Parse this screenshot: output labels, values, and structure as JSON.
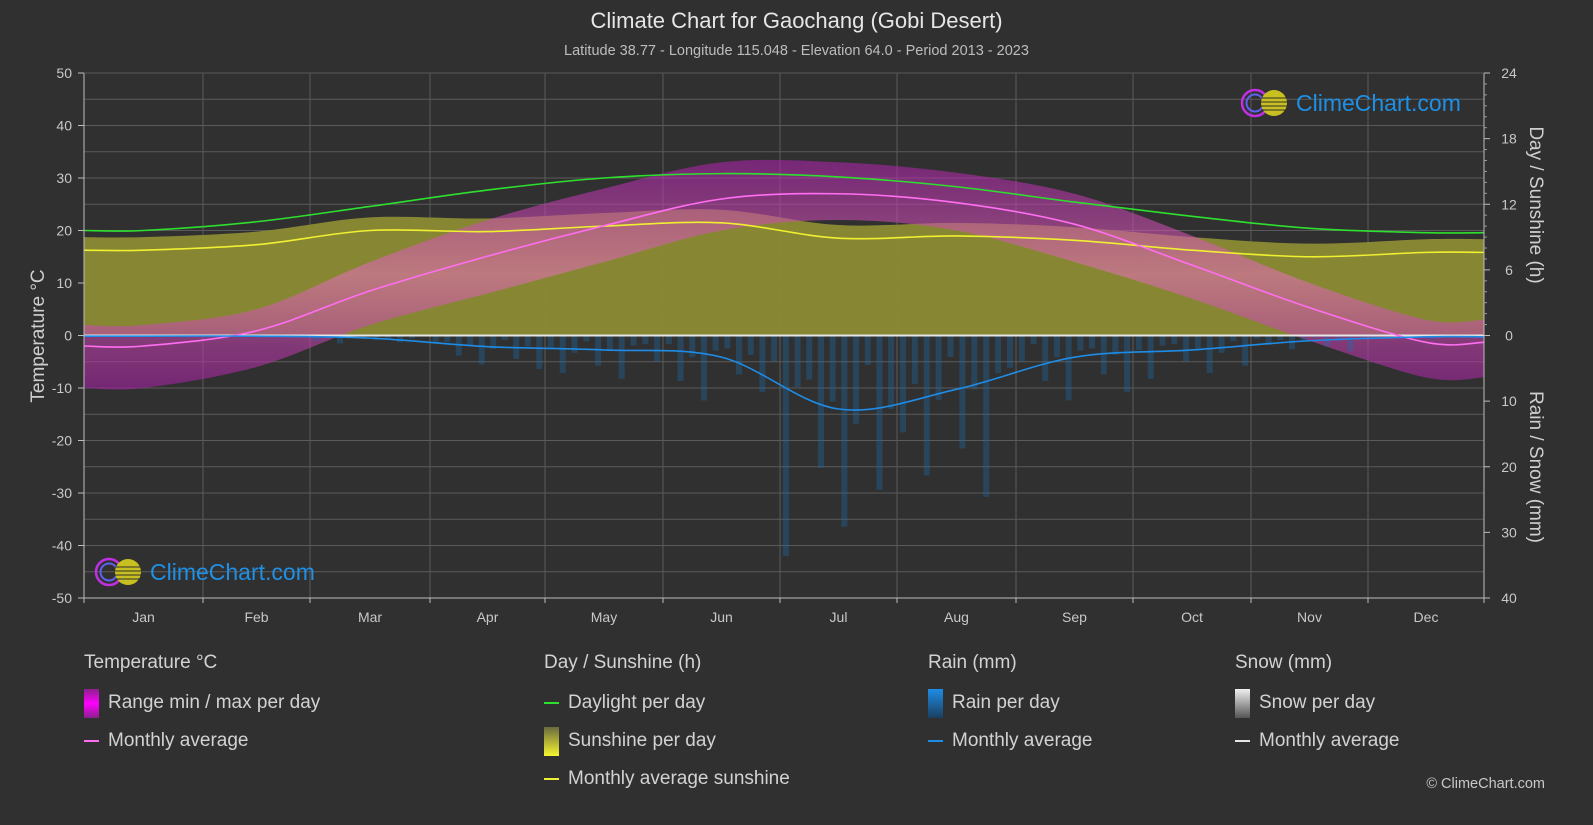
{
  "header": {
    "title": "Climate Chart for Gaochang (Gobi Desert)",
    "subtitle": "Latitude 38.77 - Longitude 115.048 - Elevation 64.0 - Period 2013 - 2023"
  },
  "logo_text": "ClimeChart.com",
  "copyright": "© ClimeChart.com",
  "colors": {
    "background": "#303030",
    "grid": "#5a5a5a",
    "temperature_range": "#e000e0",
    "temperature_avg": "#ff6ef0",
    "daylight": "#2ee02e",
    "sunshine_fill": "#a8a832",
    "sunshine_avg": "#f0f032",
    "rain": "#1e8ce6",
    "snow": "#9a9a9a",
    "zero_line": "#e6e6e6",
    "logo_blue": "#1e90e6"
  },
  "legend": {
    "temperature": {
      "title": "Temperature °C",
      "items": [
        "Range min / max per day",
        "Monthly average"
      ]
    },
    "sunshine": {
      "title": "Day / Sunshine (h)",
      "items": [
        "Daylight per day",
        "Sunshine per day",
        "Monthly average sunshine"
      ]
    },
    "rain": {
      "title": "Rain (mm)",
      "items": [
        "Rain per day",
        "Monthly average"
      ]
    },
    "snow": {
      "title": "Snow (mm)",
      "items": [
        "Snow per day",
        "Monthly average"
      ]
    }
  },
  "chart_data": {
    "type": "line",
    "title": "Climate Chart for Gaochang (Gobi Desert)",
    "subtitle": "Latitude 38.77 - Longitude 115.048 - Elevation 64.0 - Period 2013 - 2023",
    "categories": [
      "Jan",
      "Feb",
      "Mar",
      "Apr",
      "May",
      "Jun",
      "Jul",
      "Aug",
      "Sep",
      "Oct",
      "Nov",
      "Dec"
    ],
    "y_left": {
      "label": "Temperature °C",
      "range": [
        -50,
        50
      ],
      "ticks": [
        "50",
        "40",
        "30",
        "20",
        "10",
        "0",
        "-10",
        "-20",
        "-30",
        "-40",
        "-50"
      ]
    },
    "y_right_top": {
      "label": "Day / Sunshine (h)",
      "range": [
        0,
        24
      ],
      "ticks": [
        "24",
        "18",
        "12",
        "6",
        "0"
      ]
    },
    "y_right_bottom": {
      "label": "Rain / Snow (mm)",
      "range": [
        0,
        40
      ],
      "ticks": [
        "10",
        "20",
        "30",
        "40"
      ]
    },
    "grid": true,
    "series": [
      {
        "name": "Temperature monthly average",
        "axis": "temperature",
        "values": [
          -2.0,
          0.9,
          8.5,
          15.1,
          20.9,
          26.0,
          27.0,
          25.3,
          21.2,
          13.4,
          5.3,
          -1.3
        ]
      },
      {
        "name": "Temperature daily max (approx envelope)",
        "axis": "temperature",
        "values": [
          2,
          5,
          14,
          22,
          28,
          33,
          33,
          31,
          27,
          19,
          10,
          3
        ]
      },
      {
        "name": "Temperature daily min (approx envelope)",
        "axis": "temperature",
        "values": [
          -10,
          -6,
          2,
          8,
          14,
          20,
          22,
          20,
          14,
          7,
          -1,
          -8
        ]
      },
      {
        "name": "Daylight per day",
        "axis": "sunshine",
        "values": [
          9.6,
          10.4,
          11.8,
          13.3,
          14.4,
          14.8,
          14.5,
          13.6,
          12.2,
          10.9,
          9.8,
          9.4
        ]
      },
      {
        "name": "Monthly average sunshine",
        "axis": "sunshine",
        "values": [
          7.8,
          8.3,
          9.6,
          9.5,
          10.0,
          10.3,
          8.9,
          9.1,
          8.7,
          7.8,
          7.2,
          7.6
        ]
      },
      {
        "name": "Rain monthly average",
        "axis": "precipitation",
        "values": [
          0.1,
          0.1,
          0.4,
          1.7,
          2.2,
          3.3,
          11.2,
          8.2,
          3.3,
          2.2,
          0.8,
          0.2
        ]
      },
      {
        "name": "Snow monthly average",
        "axis": "precipitation",
        "values": [
          0.0,
          0.0,
          0.0,
          0.0,
          0.0,
          0.0,
          0.0,
          0.0,
          0.0,
          0.0,
          0.0,
          0.0
        ]
      }
    ],
    "legend_position": "bottom"
  }
}
